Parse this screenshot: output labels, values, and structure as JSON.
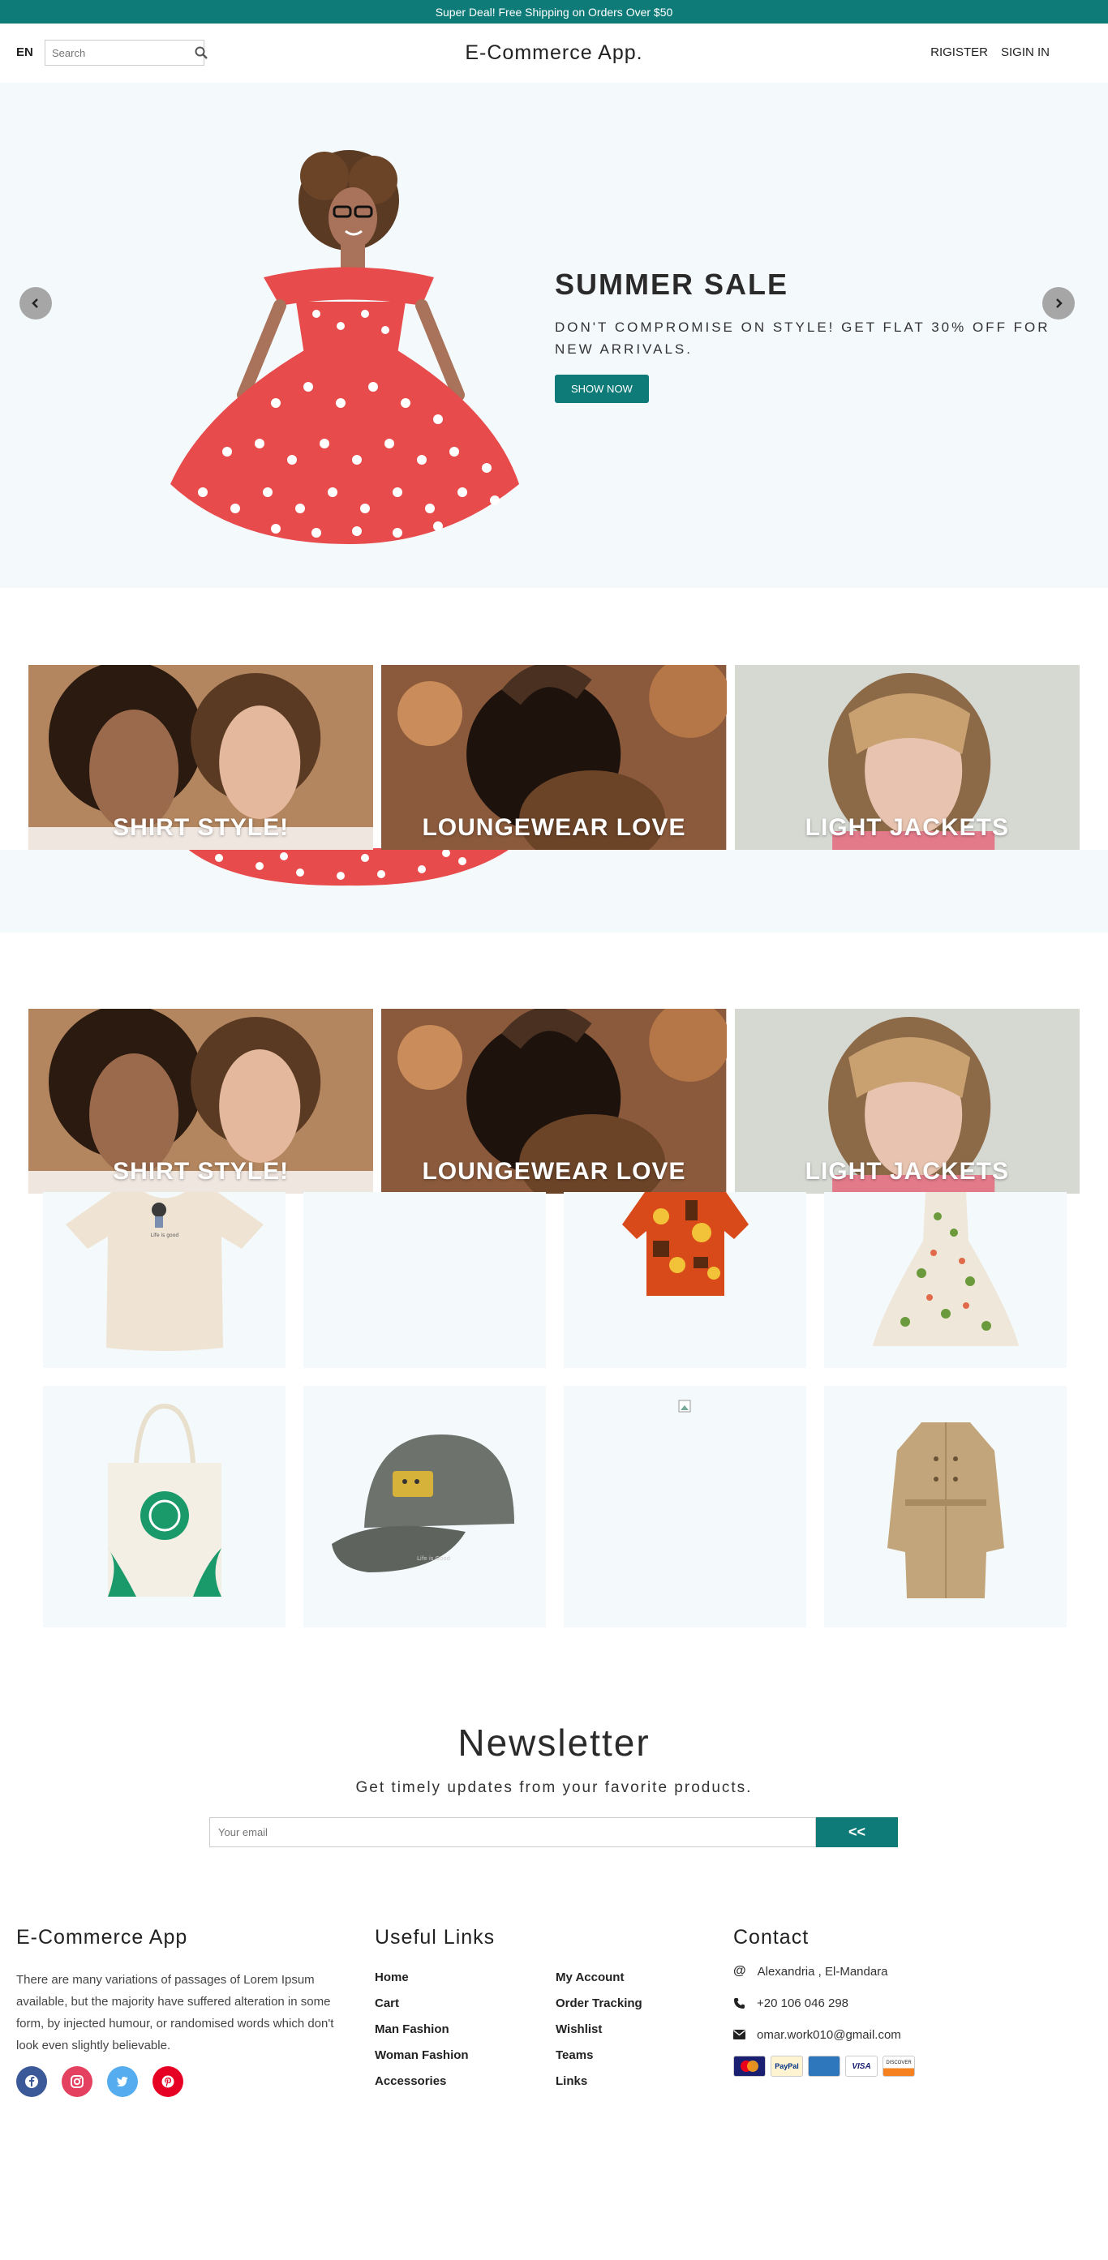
{
  "announcement": "Super Deal! Free Shipping on Orders Over $50",
  "nav": {
    "language": "EN",
    "search_placeholder": "Search",
    "brand": "E-Commerce App.",
    "register": "RIGISTER",
    "signin": "SIGIN IN"
  },
  "hero": {
    "title": "SUMMER SALE",
    "description": "DON'T COMPROMISE ON STYLE! GET FLAT 30% OFF FOR NEW ARRIVALS.",
    "button": "SHOW NOW"
  },
  "categories": [
    {
      "label": "SHIRT STYLE!"
    },
    {
      "label": "LOUNGEWEAR LOVE"
    },
    {
      "label": "LIGHT JACKETS"
    }
  ],
  "newsletter": {
    "title": "Newsletter",
    "description": "Get timely updates from your favorite products.",
    "placeholder": "Your email",
    "button": "<<"
  },
  "footer": {
    "about_title": "E-Commerce App",
    "about_text": "There are many variations of passages of Lorem Ipsum available, but the majority have suffered alteration in some form, by injected humour, or randomised words which don't look even slightly believable.",
    "social": [
      "facebook-icon",
      "instagram-icon",
      "twitter-icon",
      "pinterest-icon"
    ],
    "links_title": "Useful Links",
    "links": [
      "Home",
      "My Account",
      "Cart",
      "Order Tracking",
      "Man Fashion",
      "Wishlist",
      "Woman Fashion",
      "Teams",
      "Accessories",
      "Links"
    ],
    "contact_title": "Contact",
    "address": "Alexandria , El-Mandara",
    "phone": "+20 106 046 298",
    "email": "omar.work010@gmail.com",
    "payment_cards": [
      "MasterCard",
      "PayPal",
      "American Express",
      "VISA",
      "DISCOVER"
    ]
  },
  "colors": {
    "accent": "#0f7b78",
    "light_bg": "#f4f9fc"
  }
}
